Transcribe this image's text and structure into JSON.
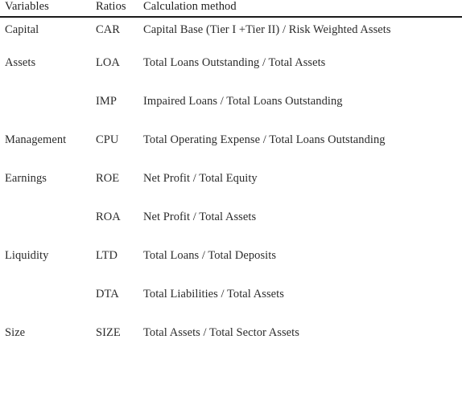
{
  "table": {
    "headers": {
      "variable": "Variables",
      "ratio": "Ratios",
      "method": "Calculation method"
    },
    "rows": [
      {
        "variable": "Capital",
        "ratio": "CAR",
        "method": "Capital Base (Tier I +Tier II) / Risk Weighted Assets"
      },
      {
        "variable": "Assets",
        "ratio": "LOA",
        "method": "Total Loans Outstanding / Total Assets"
      },
      {
        "variable": "",
        "ratio": "IMP",
        "method": "Impaired Loans / Total Loans Outstanding"
      },
      {
        "variable": "Management",
        "ratio": "CPU",
        "method": "Total Operating Expense / Total Loans Outstanding"
      },
      {
        "variable": "Earnings",
        "ratio": "ROE",
        "method": "Net Profit / Total Equity"
      },
      {
        "variable": "",
        "ratio": "ROA",
        "method": "Net Profit / Total Assets"
      },
      {
        "variable": "Liquidity",
        "ratio": "LTD",
        "method": "Total Loans / Total Deposits"
      },
      {
        "variable": "",
        "ratio": "DTA",
        "method": "Total Liabilities / Total Assets"
      },
      {
        "variable": "Size",
        "ratio": "SIZE",
        "method": "Total Assets / Total Sector Assets"
      }
    ]
  },
  "style": {
    "text_color": "#2b2b2b",
    "rule_color": "#1a1a1a",
    "background": "#ffffff"
  }
}
